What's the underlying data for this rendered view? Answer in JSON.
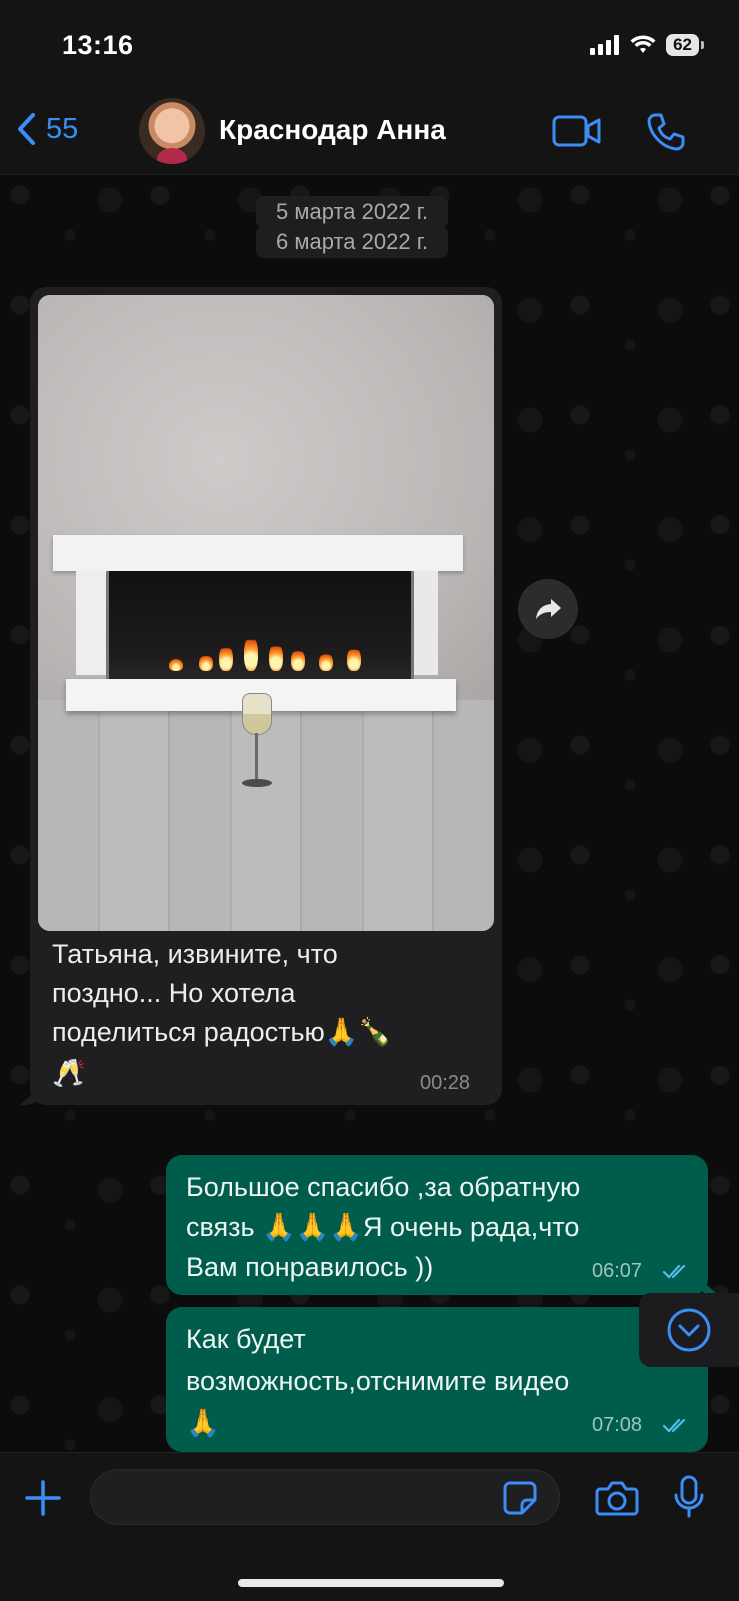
{
  "status_bar": {
    "time": "13:16",
    "battery": "62"
  },
  "header": {
    "back_count": "55",
    "contact_name": "Краснодар Анна",
    "icons": [
      "video-camera-icon",
      "phone-icon"
    ]
  },
  "colors": {
    "accent": "#3a8ef6",
    "incoming_bubble": "#1f1f21",
    "outgoing_bubble": "#005c4b",
    "read_ticks": "#53bdeb"
  },
  "chat": {
    "dates": [
      "5 марта 2022 г.",
      "6 марта 2022 г."
    ],
    "incoming": {
      "image_alt": "fireplace-photo",
      "line1": "Татьяна, извините, что",
      "line2": "поздно... Но хотела",
      "line3": "поделиться радостью🙏🍾",
      "line4": "🥂",
      "time": "00:28"
    },
    "outgoing": [
      {
        "line1": "Большое спасибо ,за обратную",
        "line2": "связь 🙏🙏🙏Я очень рада,что",
        "line3": "Вам понравилось ))",
        "time": "06:07",
        "status": "read"
      },
      {
        "line1": "Как будет",
        "line2": "возможность,отснимите видео",
        "line3": "🙏",
        "time": "07:08",
        "status": "read"
      }
    ]
  },
  "input": {
    "placeholder": ""
  }
}
